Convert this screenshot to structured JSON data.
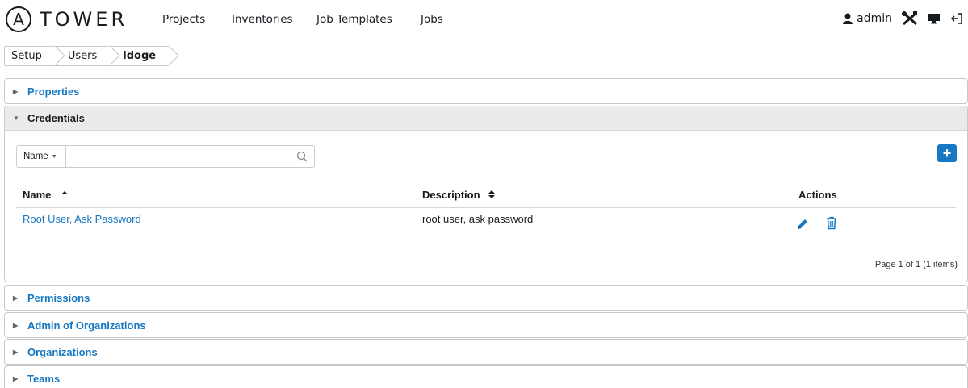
{
  "navbar": {
    "logo_glyph": "A",
    "logo_text": "TOWER",
    "links": [
      "Projects",
      "Inventories",
      "Job Templates",
      "Jobs"
    ],
    "user": "admin",
    "icons": [
      "person-icon",
      "tools-icon",
      "monitor-icon",
      "logout-icon"
    ]
  },
  "breadcrumb": [
    "Setup",
    "Users",
    "ldoge"
  ],
  "sections": {
    "properties": "Properties",
    "credentials": "Credentials",
    "permissions": "Permissions",
    "admin_orgs": "Admin of Organizations",
    "organizations": "Organizations",
    "teams": "Teams"
  },
  "credentials": {
    "search_field": "Name",
    "search_placeholder": "",
    "add_label": "+",
    "columns": {
      "name": "Name",
      "description": "Description",
      "actions": "Actions"
    },
    "rows": [
      {
        "name": "Root User, Ask Password",
        "description": "root user, ask password"
      }
    ],
    "pager": "Page 1 of 1 (1 items)"
  },
  "colors": {
    "link": "#1778c3",
    "header_bg": "#ebebeb",
    "border": "#c8c8c8"
  }
}
